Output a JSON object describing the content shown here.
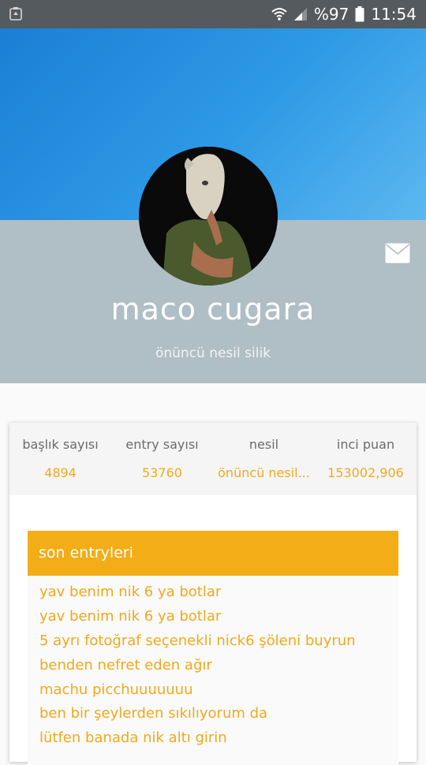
{
  "status_bar": {
    "battery_text": "%97",
    "time": "11:54",
    "left_icon": "recycle-icon",
    "icons": [
      "wifi-icon",
      "signal-icon",
      "battery-icon"
    ]
  },
  "profile": {
    "name": "maco cugara",
    "subtitle": "önüncü nesil silik",
    "message_icon": "mail-icon"
  },
  "stats": [
    {
      "label": "başlık sayısı",
      "value": "4894"
    },
    {
      "label": "entry sayısı",
      "value": "53760"
    },
    {
      "label": "nesil",
      "value": "önüncü nesil..."
    },
    {
      "label": "inci puan",
      "value": "153002,906"
    }
  ],
  "recent": {
    "title": "son entryleri",
    "items": [
      "yav benim nik 6 ya botlar",
      "yav benim nik 6 ya botlar",
      "5 ayrı fotoğraf seçenekli nick6 şöleni buyrun",
      "benden nefret eden ağır",
      "machu picchuuuuuuu",
      "ben bir şeylerden sıkılıyorum da",
      "lütfen banada nik altı girin"
    ]
  },
  "colors": {
    "accent": "#f3ad16",
    "banner": "#1f88db",
    "header_grey": "#b0bec5",
    "status_bar": "#555a5e"
  }
}
